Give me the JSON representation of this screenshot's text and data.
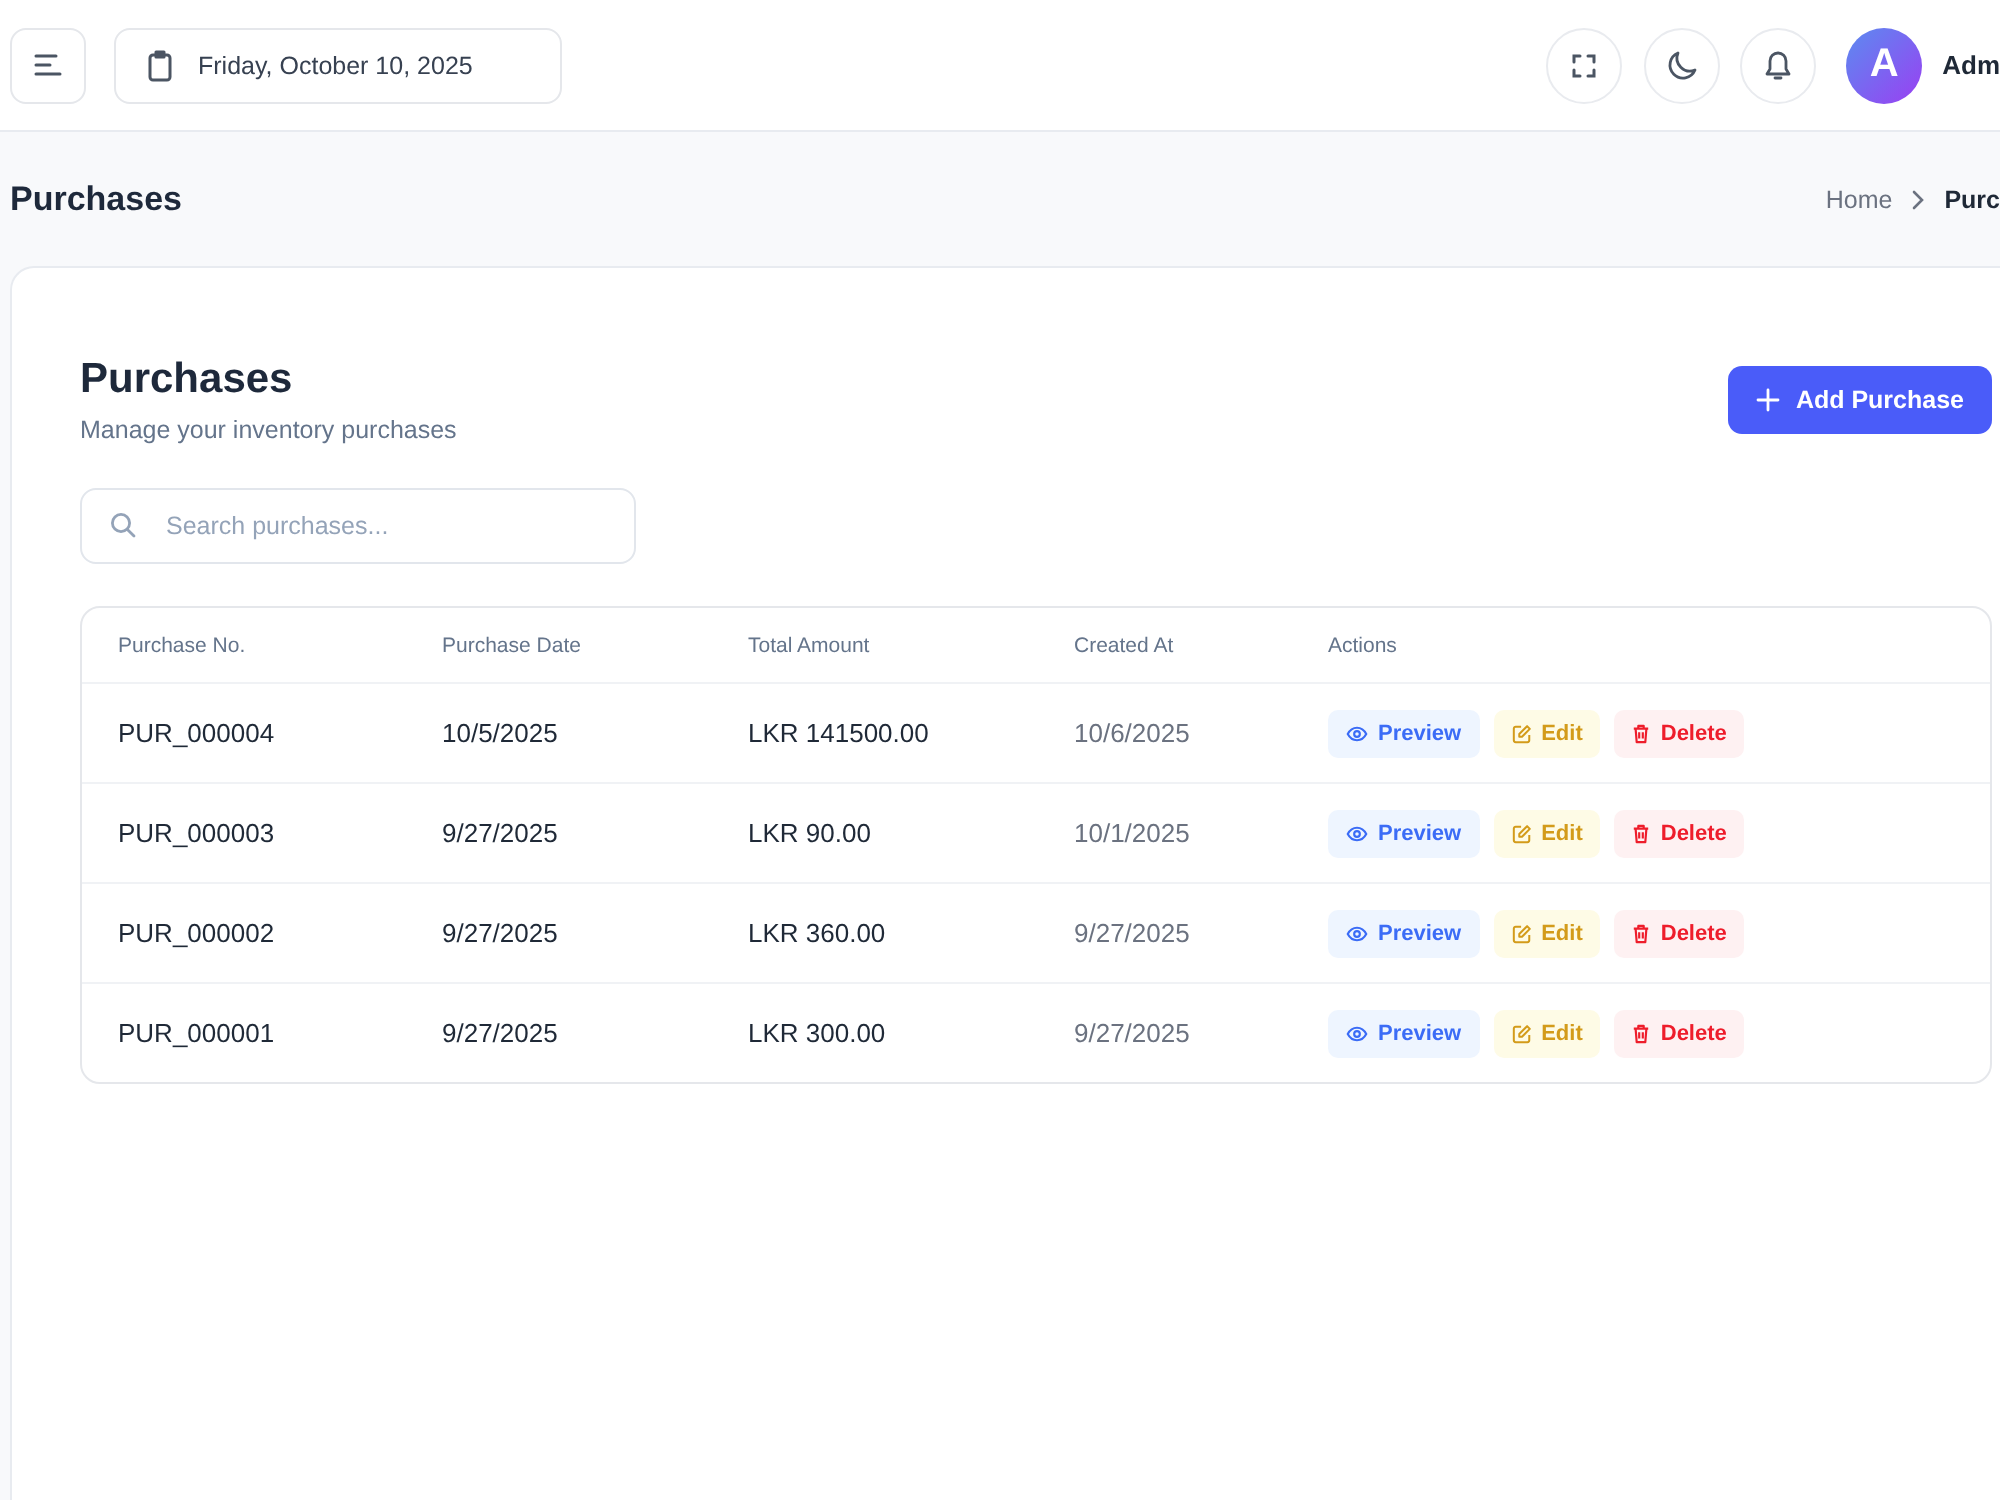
{
  "top_bar": {
    "date": "Friday, October 10, 2025",
    "user": {
      "initial": "A",
      "name": "Adm"
    }
  },
  "page_header": {
    "title": "Purchases",
    "breadcrumb": [
      {
        "label": "Home",
        "current": false
      },
      {
        "label": "Purc",
        "current": true
      }
    ]
  },
  "card": {
    "title": "Purchases",
    "subtitle": "Manage your inventory purchases",
    "add_button": "Add Purchase",
    "search": {
      "placeholder": "Search purchases..."
    }
  },
  "table": {
    "columns": [
      "Purchase No.",
      "Purchase Date",
      "Total Amount",
      "Created At",
      "Actions"
    ],
    "rows": [
      {
        "cells": [
          "PUR_000004",
          "10/5/2025",
          "LKR 141500.00",
          "10/6/2025"
        ],
        "actions": [
          {
            "kind": "preview",
            "label": "Preview"
          },
          {
            "kind": "edit",
            "label": "Edit"
          },
          {
            "kind": "delete",
            "label": "Delete"
          }
        ]
      },
      {
        "cells": [
          "PUR_000003",
          "9/27/2025",
          "LKR 90.00",
          "10/1/2025"
        ],
        "actions": [
          {
            "kind": "preview",
            "label": "Preview"
          },
          {
            "kind": "edit",
            "label": "Edit"
          },
          {
            "kind": "delete",
            "label": "Delete"
          }
        ]
      },
      {
        "cells": [
          "PUR_000002",
          "9/27/2025",
          "LKR 360.00",
          "9/27/2025"
        ],
        "actions": [
          {
            "kind": "preview",
            "label": "Preview"
          },
          {
            "kind": "edit",
            "label": "Edit"
          },
          {
            "kind": "delete",
            "label": "Delete"
          }
        ]
      },
      {
        "cells": [
          "PUR_000001",
          "9/27/2025",
          "LKR 300.00",
          "9/27/2025"
        ],
        "actions": [
          {
            "kind": "preview",
            "label": "Preview"
          },
          {
            "kind": "edit",
            "label": "Edit"
          },
          {
            "kind": "delete",
            "label": "Delete"
          }
        ]
      }
    ]
  }
}
